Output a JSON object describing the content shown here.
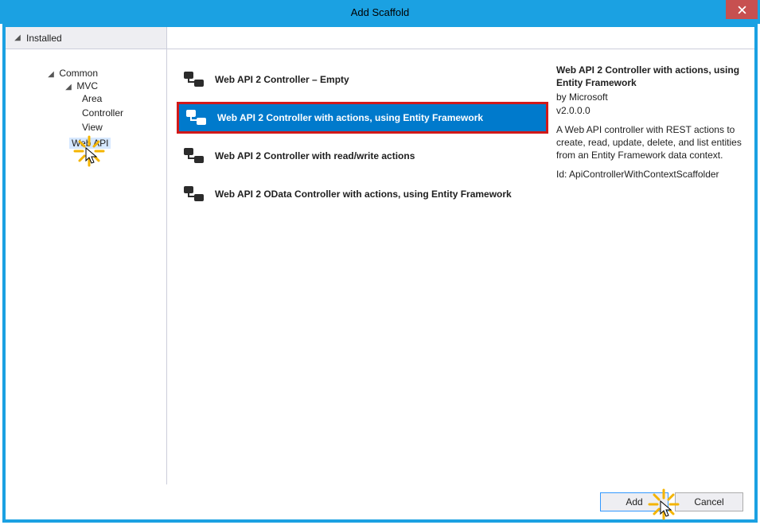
{
  "window": {
    "title": "Add Scaffold"
  },
  "tab": {
    "label": "Installed"
  },
  "tree": {
    "common": "Common",
    "mvc": "MVC",
    "area": "Area",
    "controller": "Controller",
    "view": "View",
    "webapi": "Web API"
  },
  "templates": [
    {
      "label": "Web API 2 Controller – Empty",
      "selected": false
    },
    {
      "label": "Web API 2 Controller with actions, using Entity Framework",
      "selected": true
    },
    {
      "label": "Web API 2 Controller with read/write actions",
      "selected": false
    },
    {
      "label": "Web API 2 OData Controller with actions, using Entity Framework",
      "selected": false
    }
  ],
  "info": {
    "title": "Web API 2 Controller with actions, using Entity Framework",
    "publisher": "by Microsoft",
    "version": "v2.0.0.0",
    "description": "A Web API controller with REST actions to create, read, update, delete, and list entities from an Entity Framework data context.",
    "id": "Id: ApiControllerWithContextScaffolder"
  },
  "buttons": {
    "add": "Add",
    "cancel": "Cancel"
  }
}
